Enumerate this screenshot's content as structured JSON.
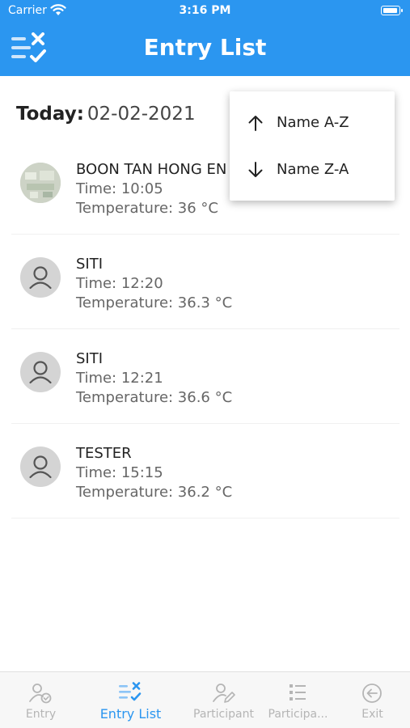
{
  "status": {
    "carrier": "Carrier",
    "time": "3:16 PM"
  },
  "header": {
    "title": "Entry List",
    "menu_icon": "checklist-icon"
  },
  "today": {
    "label": "Today:",
    "date": "02-02-2021"
  },
  "entries": [
    {
      "name": "BOON TAN HONG EN",
      "time": "Time: 10:05",
      "temperature": "Temperature: 36 °C",
      "avatar": "photo"
    },
    {
      "name": "SITI",
      "time": "Time: 12:20",
      "temperature": "Temperature: 36.3 °C",
      "avatar": "default-person-icon"
    },
    {
      "name": "SITI",
      "time": "Time: 12:21",
      "temperature": "Temperature: 36.6 °C",
      "avatar": "default-person-icon"
    },
    {
      "name": "TESTER",
      "time": "Time: 15:15",
      "temperature": "Temperature: 36.2 °C",
      "avatar": "default-person-icon"
    }
  ],
  "sort_menu": {
    "items": [
      {
        "label": "Name A-Z",
        "icon": "arrow-up-icon"
      },
      {
        "label": "Name Z-A",
        "icon": "arrow-down-icon"
      }
    ]
  },
  "tabs": [
    {
      "label": "Entry",
      "icon": "person-check-icon",
      "active": false
    },
    {
      "label": "Entry List",
      "icon": "checklist-icon",
      "active": true
    },
    {
      "label": "Participant",
      "icon": "person-edit-icon",
      "active": false
    },
    {
      "label": "Participa...",
      "icon": "list-icon",
      "active": false
    },
    {
      "label": "Exit",
      "icon": "exit-icon",
      "active": false
    }
  ],
  "colors": {
    "primary": "#2b96f0",
    "inactive": "#b5b5b5"
  }
}
